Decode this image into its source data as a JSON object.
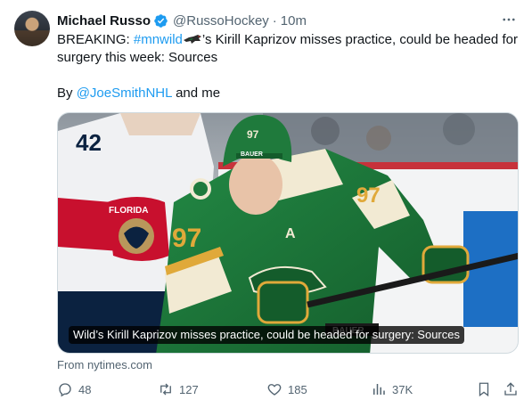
{
  "tweet": {
    "author_name": "Michael Russo",
    "author_handle": "@RussoHockey",
    "separator": "·",
    "time": "10m",
    "text_prefix": "BREAKING: ",
    "hashtag": "#mnwild",
    "text_main": "’s Kirill Kaprizov misses practice, could be headed for surgery this week: Sources",
    "byline_prefix": "By ",
    "mention": "@JoeSmithNHL",
    "byline_suffix": " and me",
    "hashtag_emoji_icon": "minnesota-wild-bird-icon"
  },
  "media": {
    "caption": "Wild’s Kirill Kaprizov misses practice, could be headed for surgery: Sources",
    "player_number": "97",
    "player_number_alt": "42",
    "jersey_text": "FLORIDA",
    "helmet_brand": "BAUER",
    "colors": {
      "wild_green": "#1f7a3c",
      "wild_cream": "#f2ead3",
      "wild_gold": "#e0a93a",
      "panthers_red": "#c8102e"
    }
  },
  "card": {
    "source": "From nytimes.com"
  },
  "actions": {
    "replies": "48",
    "reposts": "127",
    "likes": "185",
    "views": "37K"
  },
  "colors": {
    "link": "#1d9bf0",
    "secondary_text": "#536471",
    "verified": "#1d9bf0"
  }
}
